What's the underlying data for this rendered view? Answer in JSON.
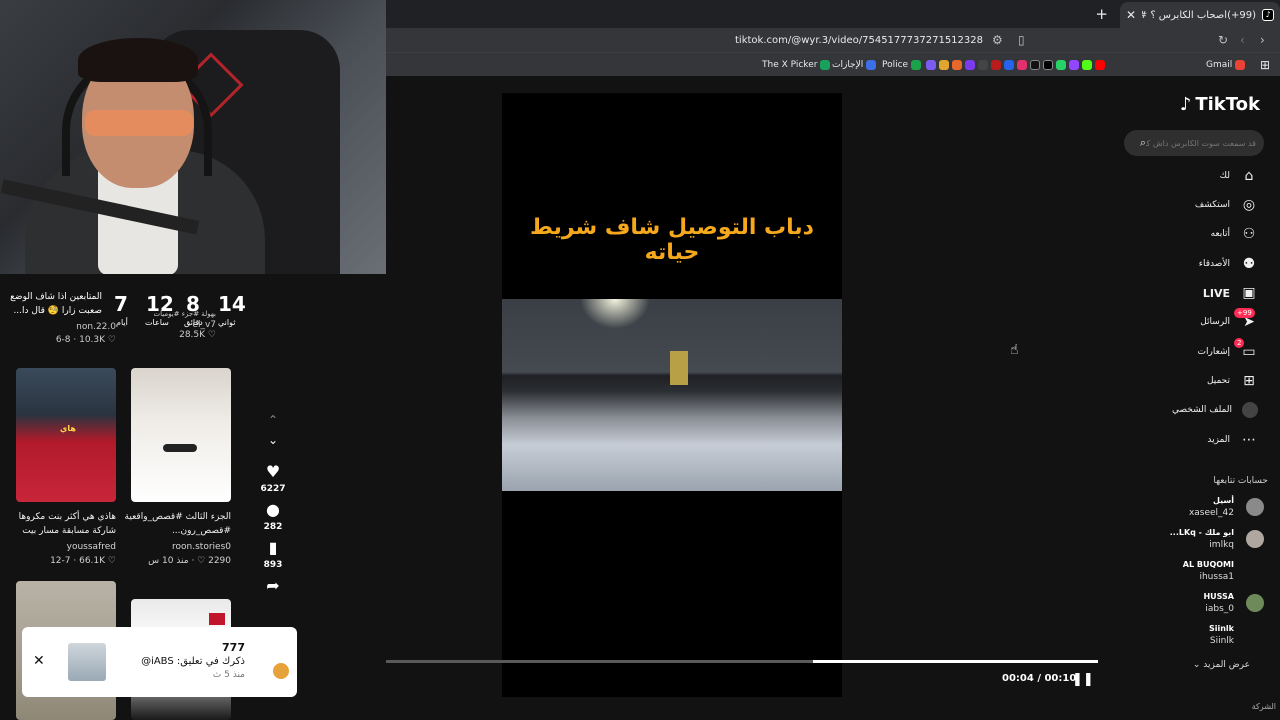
{
  "browser": {
    "tab_title": "(99+)أصحاب الكابرس ؟ #داش",
    "tab_favicon": "tiktok-icon",
    "url": "tiktok.com/@wyr.3/video/7545177737271512328",
    "bookmarks": [
      "Gmail",
      "The X Picker",
      "الإجازات",
      "Police"
    ]
  },
  "feed": {
    "top_items": [
      {
        "caption": "المتابعين اذا شاف الوضع صعبت زارا 🧐 قال دا...",
        "user": "non.22.0",
        "likes": "10.3K",
        "ago": "6-8"
      },
      {
        "caption": "بهولة #جزء #يوميات",
        "user": "el_v7",
        "likes": "28.5K",
        "ago": ""
      }
    ],
    "countdown": {
      "n1": "7",
      "n2": "12",
      "n3": "8",
      "n4": "14",
      "l1": "أيام",
      "l2": "ساعات",
      "l3": "دقائق",
      "l4": "ثواني"
    },
    "items": [
      {
        "caption": "هاذي هي أكثر بنت مكروها شاركة مسابقة مسار بيت",
        "user": "youssafred",
        "likes": "66.1K",
        "ago": "12-7"
      },
      {
        "caption": "الجزء الثالث #قصص_واقعية #قصص_رون...",
        "user": "roon.stories0",
        "likes": "2290",
        "ago": "منذ 10 س"
      }
    ],
    "thumb_label": "هاي"
  },
  "actions": {
    "likes": "6227",
    "comments": "282",
    "saves": "893"
  },
  "notification": {
    "name": "777",
    "text": "ذكرك في تعليق: iABS@",
    "time": "منذ 5 ث"
  },
  "video": {
    "overlay_text": "دباب التوصيل شاف شريط حياته",
    "time": "00:04 / 00:10",
    "progress": 0.4
  },
  "sidebar": {
    "logo": "TikTok",
    "search_placeholder": "قد سمعت سوت الكابرس داش كم",
    "nav": [
      {
        "label": "لك",
        "icon": "home-icon"
      },
      {
        "label": "استكشف",
        "icon": "compass-icon"
      },
      {
        "label": "أتابعه",
        "icon": "following-icon"
      },
      {
        "label": "الأصدقاء",
        "icon": "friends-icon"
      },
      {
        "label": "LIVE",
        "icon": "live-icon"
      },
      {
        "label": "الرسائل",
        "icon": "messages-icon",
        "badge": "99+"
      },
      {
        "label": "إشعارات",
        "icon": "bell-icon",
        "badge": "2"
      },
      {
        "label": "تحميل",
        "icon": "upload-icon"
      },
      {
        "label": "الملف الشخصي",
        "icon": "profile-icon"
      },
      {
        "label": "المزيد",
        "icon": "more-icon"
      }
    ],
    "following_title": "حسابات تتابعها",
    "accounts": [
      {
        "name": "أسيل",
        "handle": "xaseel_42"
      },
      {
        "name": "ابو ملك - LKq...",
        "handle": "imlkq"
      },
      {
        "name": "AL BUQOMI",
        "handle": "ihussa1"
      },
      {
        "name": "HUSSA",
        "handle": "iabs_0"
      },
      {
        "name": "Siinlk",
        "handle": "Siinlk"
      }
    ],
    "see_more": "عرض المزيد",
    "company": "الشركة"
  }
}
